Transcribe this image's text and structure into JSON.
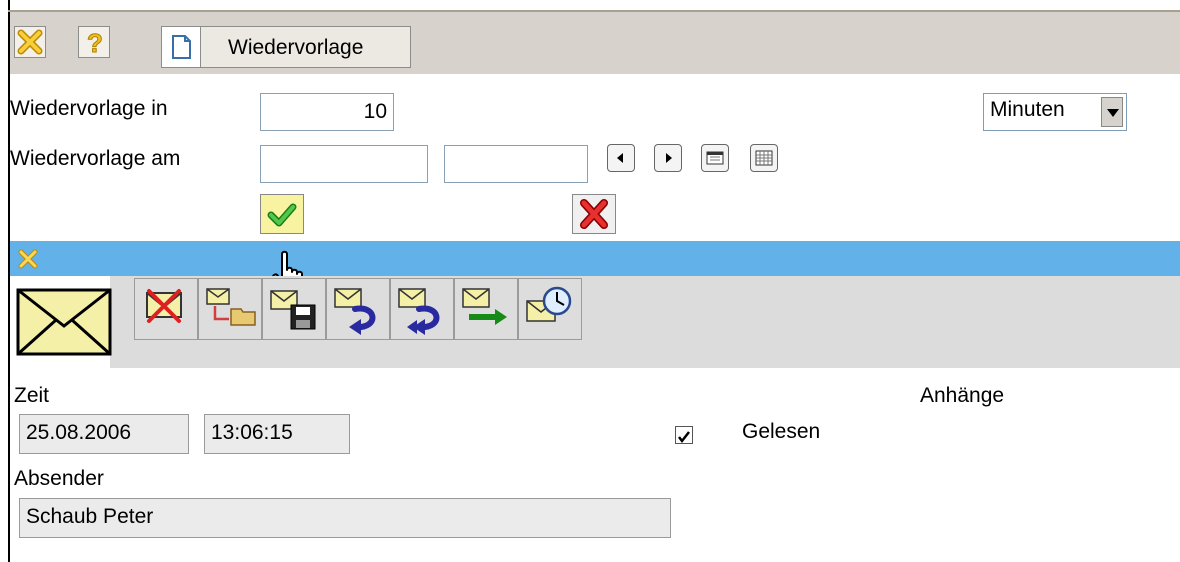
{
  "toolbar": {
    "close_icon": "close-icon",
    "help_icon": "help-icon",
    "wiedervorlage_label": "Wiedervorlage"
  },
  "form": {
    "wiedervorlage_in_label": "Wiedervorlage in",
    "wiedervorlage_in_value": "10",
    "unit_select_value": "Minuten",
    "wiedervorlage_am_label": "Wiedervorlage am",
    "date_value": "",
    "time_value": ""
  },
  "mail_toolbar": {
    "buttons": [
      "delete-mail",
      "move-to-folder",
      "save-mail",
      "reply",
      "reply-all",
      "forward",
      "schedule"
    ]
  },
  "message": {
    "zeit_label": "Zeit",
    "date": "25.08.2006",
    "time": "13:06:15",
    "gelesen_label": "Gelesen",
    "gelesen_checked": true,
    "anhaenge_label": "Anhänge",
    "absender_label": "Absender",
    "absender_value": "Schaub Peter"
  },
  "colors": {
    "toolbar_bg": "#d8d2cc",
    "blue_bar": "#62b1e8",
    "mail_toolbar_bg": "#dcdcdc"
  }
}
